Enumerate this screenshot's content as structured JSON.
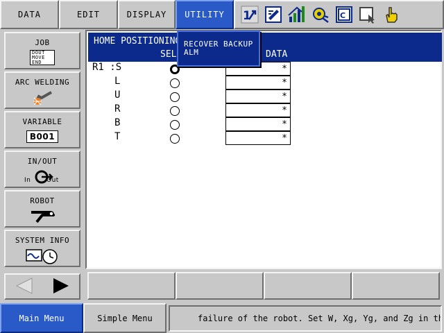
{
  "menu": {
    "tabs": [
      {
        "label": "DATA"
      },
      {
        "label": "EDIT"
      },
      {
        "label": "DISPLAY"
      },
      {
        "label": "UTILITY",
        "active": true
      }
    ]
  },
  "toolbar": {
    "icons": [
      "axis-order-icon",
      "edit-page-icon",
      "signal-bars-icon",
      "gear-link-icon",
      "register-icon",
      "cursor-window-icon",
      "hand-pointer-icon"
    ],
    "icon_glyph_1": "1½"
  },
  "side_panel": {
    "buttons": [
      {
        "label": "JOB",
        "sub_lines": [
          "DOUT",
          "MOVE",
          "END"
        ]
      },
      {
        "label": "ARC WELDING"
      },
      {
        "label": "VARIABLE",
        "sub": "B001"
      },
      {
        "label": "IN/OUT",
        "sub_in": "In",
        "sub_out": "Out"
      },
      {
        "label": "ROBOT"
      },
      {
        "label": "SYSTEM INFO"
      }
    ]
  },
  "main": {
    "title": "HOME POSITIONING",
    "col_select": "SEL",
    "col_data": "DATA",
    "rows": [
      {
        "label": "R1 :S",
        "selected": true,
        "value": "*"
      },
      {
        "label": "L",
        "selected": false,
        "value": "*"
      },
      {
        "label": "U",
        "selected": false,
        "value": "*"
      },
      {
        "label": "R",
        "selected": false,
        "value": "*"
      },
      {
        "label": "B",
        "selected": false,
        "value": "*"
      },
      {
        "label": "T",
        "selected": false,
        "value": "*"
      }
    ]
  },
  "dropdown": {
    "items": [
      {
        "label": "RECOVER BACKUP"
      },
      {
        "label": "ALM"
      }
    ]
  },
  "bottom": {
    "main_menu": "Main Menu",
    "simple_menu": "Simple Menu",
    "status": "failure of the robot. Set W, Xg, Yg, and Zg in the"
  },
  "colors": {
    "accent": "#2a5ac8",
    "title_bg": "#0b2a8c",
    "panel_bg": "#c8c8c8"
  }
}
